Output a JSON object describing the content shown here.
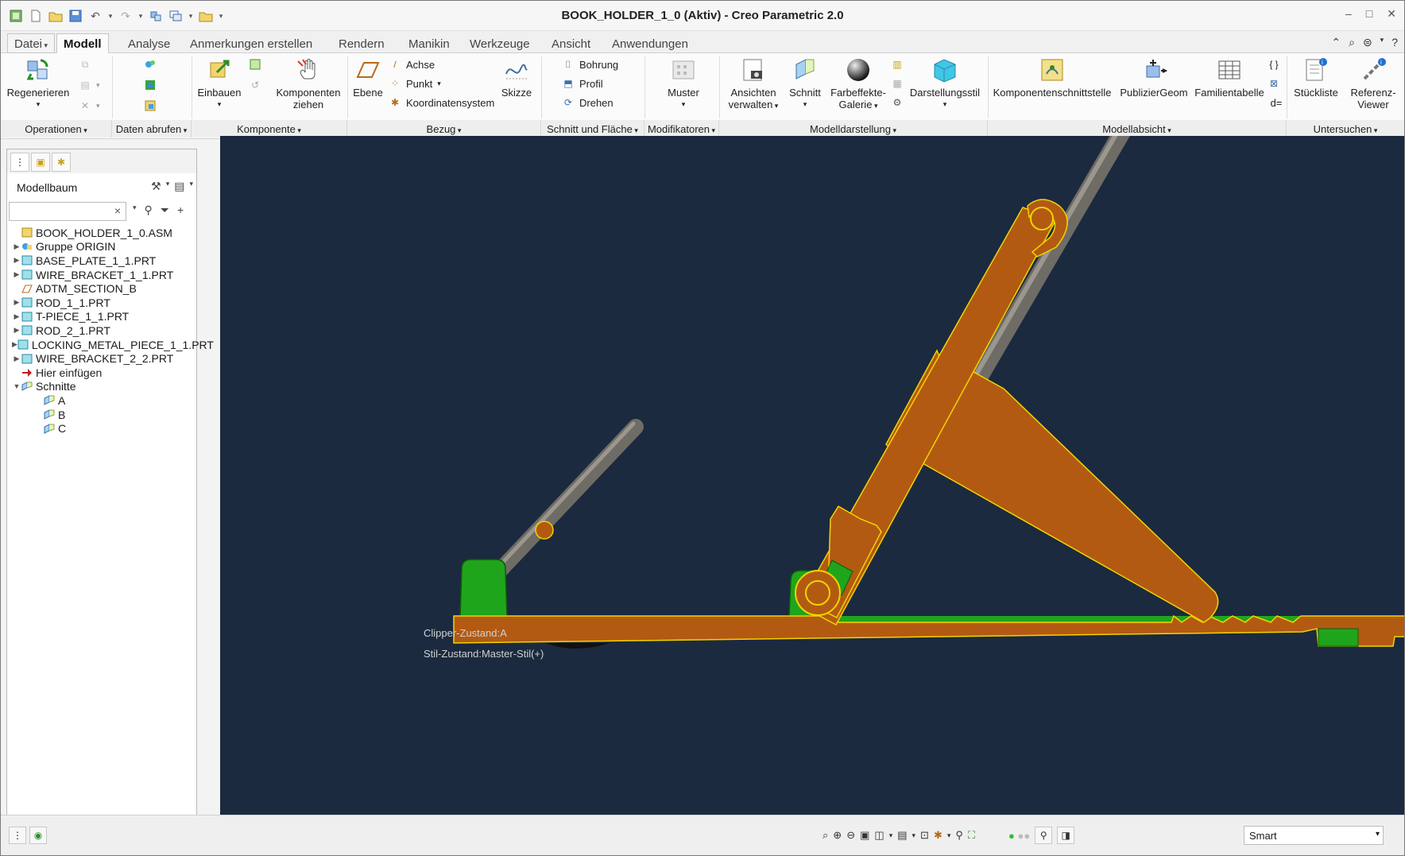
{
  "window": {
    "title": "BOOK_HOLDER_1_0 (Aktiv) - Creo Parametric 2.0",
    "controls": [
      "–",
      "□",
      "✕"
    ]
  },
  "menu": {
    "file_label": "Datei",
    "tabs": [
      "Modell",
      "Analyse",
      "Anmerkungen erstellen",
      "Rendern",
      "Manikin",
      "Werkzeuge",
      "Ansicht",
      "Anwendungen"
    ],
    "active_tab": "Modell"
  },
  "ribbon": {
    "operationen": {
      "regenerieren": "Regenerieren"
    },
    "komponente": {
      "einbauen": "Einbauen",
      "komponenten_ziehen_1": "Komponenten",
      "komponenten_ziehen_2": "ziehen"
    },
    "bezug": {
      "ebene": "Ebene",
      "achse": "Achse",
      "punkt": "Punkt",
      "koordinatensystem": "Koordinatensystem",
      "skizze": "Skizze"
    },
    "schnitt": {
      "bohrung": "Bohrung",
      "profil": "Profil",
      "drehen": "Drehen"
    },
    "modifikatoren": {
      "muster": "Muster"
    },
    "modelldarstellung": {
      "ansichten_1": "Ansichten",
      "ansichten_2": "verwalten",
      "schnitt": "Schnitt",
      "farbeffekte_1": "Farbeffekte-",
      "farbeffekte_2": "Galerie",
      "darstellungsstil": "Darstellungsstil"
    },
    "modellabsicht": {
      "komponentenschnittstelle": "Komponentenschnittstelle",
      "publiziergeom": "PublizierGeom",
      "familientabelle": "Familientabelle"
    },
    "untersuchen": {
      "stueckliste": "Stückliste",
      "referenz_1": "Referenz-",
      "referenz_2": "Viewer",
      "d_eq": "d="
    },
    "groups": [
      "Operationen",
      "Daten abrufen",
      "Komponente",
      "Bezug",
      "Schnitt und Fläche",
      "Modifikatoren",
      "Modelldarstellung",
      "Modellabsicht",
      "Untersuchen"
    ]
  },
  "panel": {
    "title": "Modellbaum",
    "tree": [
      {
        "label": "BOOK_HOLDER_1_0.ASM",
        "level": 0,
        "expand": "",
        "icon": "assembly-icon"
      },
      {
        "label": "Gruppe ORIGIN",
        "level": 0,
        "expand": "▶",
        "icon": "group-icon"
      },
      {
        "label": "BASE_PLATE_1_1.PRT",
        "level": 0,
        "expand": "▶",
        "icon": "part-icon"
      },
      {
        "label": "WIRE_BRACKET_1_1.PRT",
        "level": 0,
        "expand": "▶",
        "icon": "part-icon"
      },
      {
        "label": "ADTM_SECTION_B",
        "level": 0,
        "expand": "",
        "icon": "datum-plane-icon"
      },
      {
        "label": "ROD_1_1.PRT",
        "level": 0,
        "expand": "▶",
        "icon": "part-icon"
      },
      {
        "label": "T-PIECE_1_1.PRT",
        "level": 0,
        "expand": "▶",
        "icon": "part-icon"
      },
      {
        "label": "ROD_2_1.PRT",
        "level": 0,
        "expand": "▶",
        "icon": "part-icon"
      },
      {
        "label": "LOCKING_METAL_PIECE_1_1.PRT",
        "level": 0,
        "expand": "▶",
        "icon": "part-icon"
      },
      {
        "label": "WIRE_BRACKET_2_2.PRT",
        "level": 0,
        "expand": "▶",
        "icon": "part-icon"
      },
      {
        "label": "Hier einfügen",
        "level": 0,
        "expand": "",
        "icon": "insert-here-icon"
      },
      {
        "label": "Schnitte",
        "level": 0,
        "expand": "▼",
        "icon": "sections-folder-icon"
      },
      {
        "label": "A",
        "level": 1,
        "expand": "",
        "icon": "section-icon"
      },
      {
        "label": "B",
        "level": 1,
        "expand": "",
        "icon": "section-icon"
      },
      {
        "label": "C",
        "level": 1,
        "expand": "",
        "icon": "section-icon"
      }
    ]
  },
  "viewport": {
    "clipper_state": "Clipper-Zustand:A",
    "style_state": "Stil-Zustand:Master-Stil(+)"
  },
  "status": {
    "filter_value": "Smart"
  },
  "colors": {
    "viewport_bg": "#1b2a3f",
    "section_fill": "#b35a12",
    "section_edge": "#f2d400",
    "plate_green": "#1fa51b",
    "rod_grey": "#7d7a72"
  }
}
